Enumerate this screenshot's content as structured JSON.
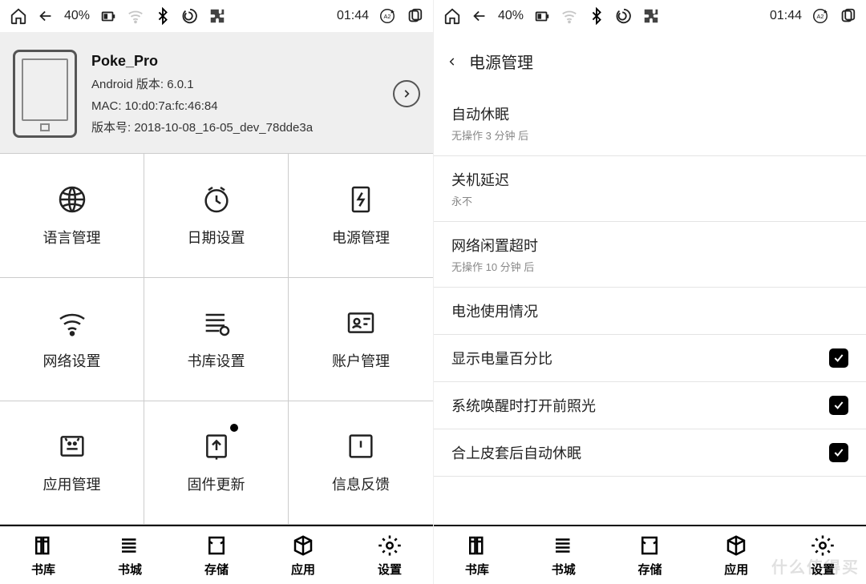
{
  "status": {
    "battery_pct": "40%",
    "time": "01:44"
  },
  "device": {
    "name": "Poke_Pro",
    "android_label": "Android 版本: 6.0.1",
    "mac_label": "MAC: 10:d0:7a:fc:46:84",
    "version_label": "版本号: 2018-10-08_16-05_dev_78dde3a"
  },
  "grid": {
    "language": "语言管理",
    "date": "日期设置",
    "power": "电源管理",
    "network": "网络设置",
    "library_settings": "书库设置",
    "account": "账户管理",
    "app_mgmt": "应用管理",
    "firmware": "固件更新",
    "feedback": "信息反馈"
  },
  "power_page": {
    "title": "电源管理",
    "auto_sleep": {
      "t": "自动休眠",
      "s": "无操作 3 分钟 后"
    },
    "shutdown_delay": {
      "t": "关机延迟",
      "s": "永不"
    },
    "net_idle": {
      "t": "网络闲置超时",
      "s": "无操作 10 分钟 后"
    },
    "battery_usage": {
      "t": "电池使用情况"
    },
    "show_pct": {
      "t": "显示电量百分比"
    },
    "wake_light": {
      "t": "系统唤醒时打开前照光"
    },
    "cover_sleep": {
      "t": "合上皮套后自动休眠"
    }
  },
  "nav": {
    "library": "书库",
    "bookstore": "书城",
    "storage": "存储",
    "apps": "应用",
    "settings": "设置"
  },
  "watermark": "什么值得买"
}
